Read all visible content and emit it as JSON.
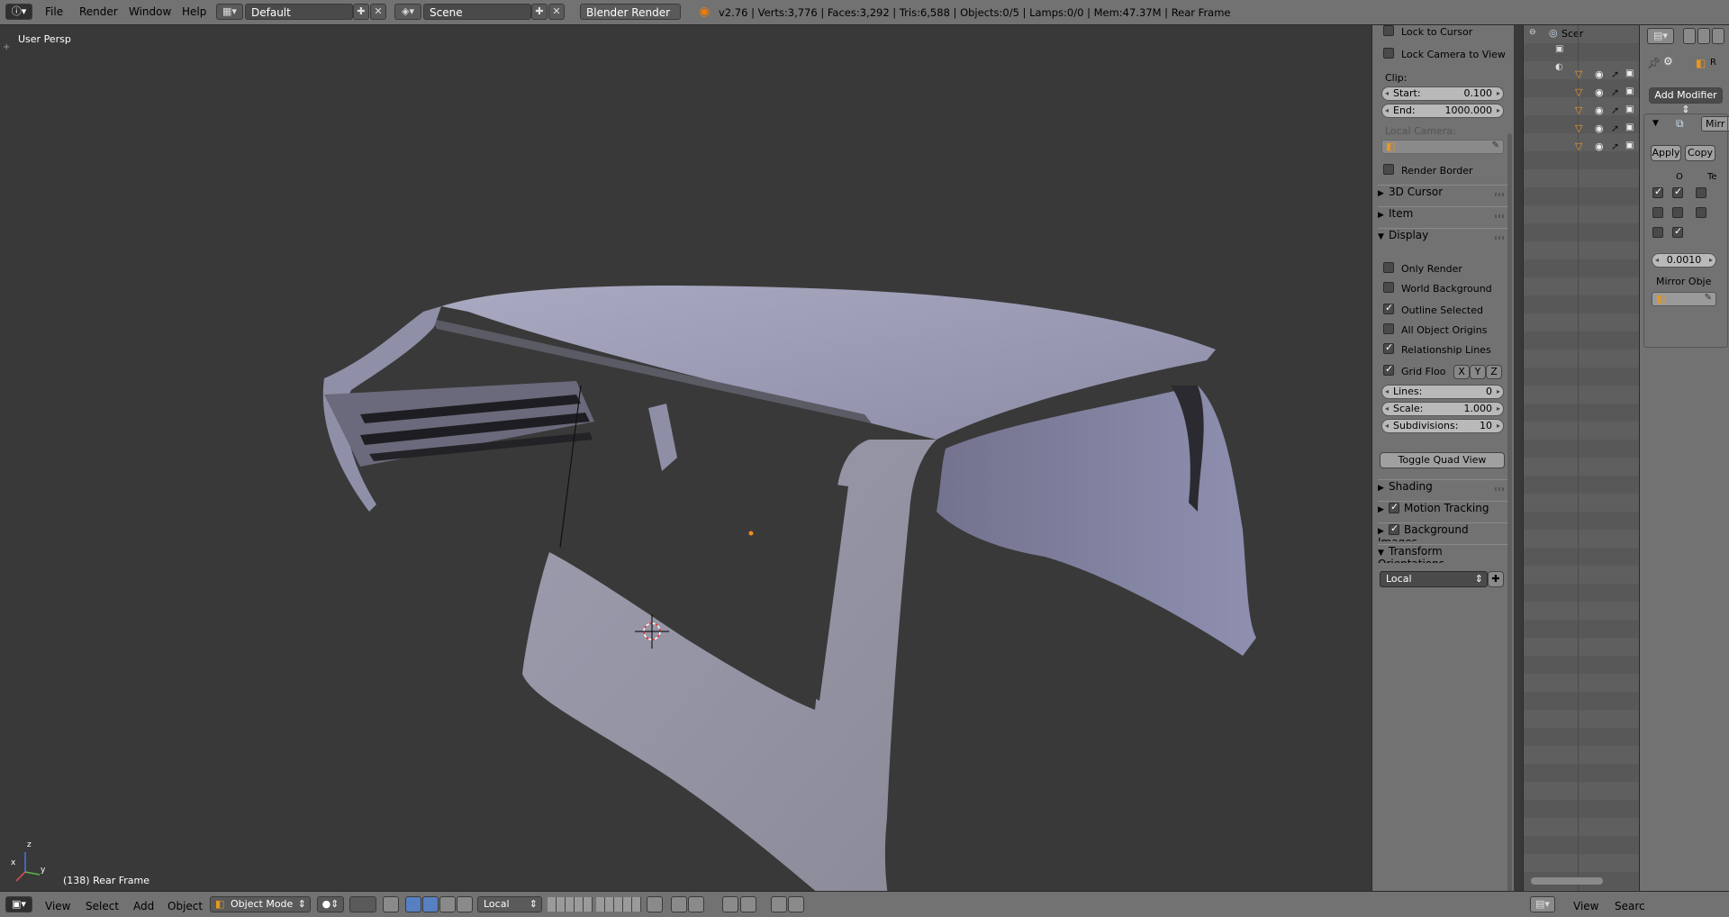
{
  "topbar": {
    "menus": [
      "File",
      "Render",
      "Window",
      "Help"
    ],
    "layout_name": "Default",
    "scene_name": "Scene",
    "render_engine": "Blender Render",
    "stats": "v2.76 | Verts:3,776 | Faces:3,292 | Tris:6,588 | Objects:0/5 | Lamps:0/0 | Mem:47.37M | Rear Frame"
  },
  "viewport": {
    "view_label": "User Persp",
    "object_label": "(138) Rear Frame",
    "axis_labels": {
      "x": "x",
      "y": "y",
      "z": "z"
    }
  },
  "npanel": {
    "lock_to_cursor": "Lock to Cursor",
    "lock_camera": "Lock Camera to View",
    "clip_label": "Clip:",
    "clip_start_label": "Start:",
    "clip_start": "0.100",
    "clip_end_label": "End:",
    "clip_end": "1000.000",
    "local_camera": "Local Camera:",
    "render_border": "Render Border",
    "sections": {
      "cursor": "3D Cursor",
      "item": "Item",
      "display": "Display",
      "shading": "Shading",
      "motion_tracking": "Motion Tracking",
      "background_images": "Background Images",
      "transform_orientations": "Transform Orientations"
    },
    "display": {
      "only_render": "Only Render",
      "world_background": "World Background",
      "outline_selected": "Outline Selected",
      "all_object_origins": "All Object Origins",
      "relationship_lines": "Relationship Lines",
      "grid_floor": "Grid Floo",
      "axis_x": "X",
      "axis_y": "Y",
      "axis_z": "Z",
      "lines_label": "Lines:",
      "lines": "0",
      "scale_label": "Scale:",
      "scale": "1.000",
      "subdivisions_label": "Subdivisions:",
      "subdivisions": "10",
      "toggle_quad_view": "Toggle Quad View"
    },
    "orientation": "Local"
  },
  "outliner": {
    "scene_label": "Scer",
    "search_label": "Searc",
    "view_label": "View"
  },
  "props": {
    "add_modifier": "Add Modifier",
    "modifier_name": "Mirr",
    "apply": "Apply",
    "copy": "Copy",
    "col_o": "O",
    "col_te": "Te",
    "merge_limit": "0.0010",
    "mirror_object": "Mirror Obje",
    "render_tab": "R"
  },
  "bottombar": {
    "menus": [
      "View",
      "Select",
      "Add",
      "Object"
    ],
    "mode": "Object Mode",
    "orientation": "Local"
  }
}
